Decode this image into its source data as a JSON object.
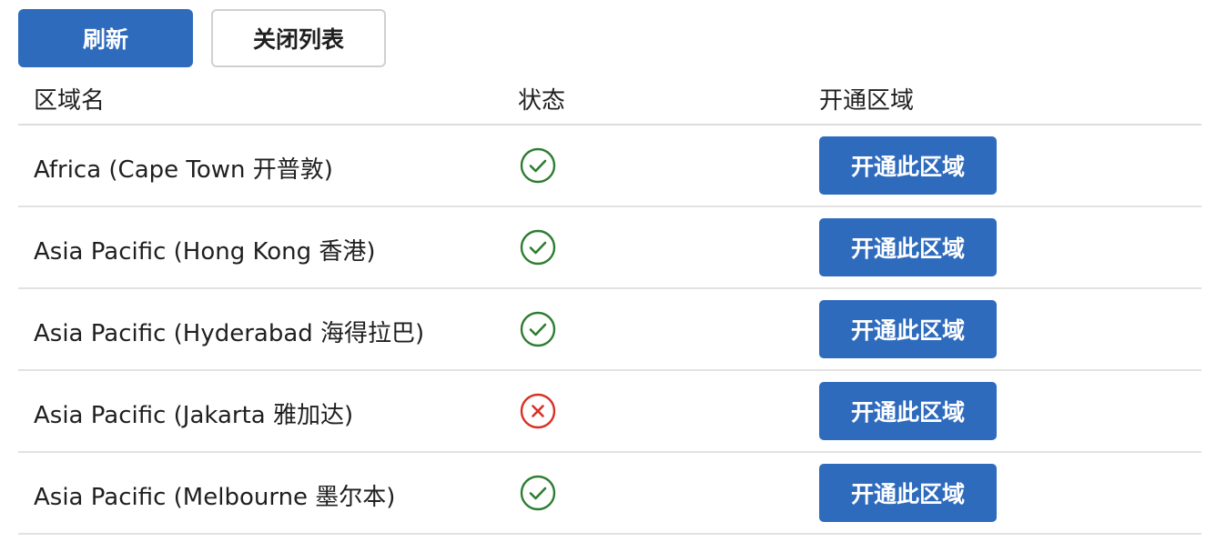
{
  "toolbar": {
    "refresh_label": "刷新",
    "close_list_label": "关闭列表"
  },
  "table": {
    "headers": {
      "region_name": "区域名",
      "status": "状态",
      "enable": "开通区域"
    },
    "rows": [
      {
        "name": "Africa (Cape Town 开普敦)",
        "status": "success",
        "action_label": "开通此区域"
      },
      {
        "name": "Asia Pacific (Hong Kong 香港)",
        "status": "success",
        "action_label": "开通此区域"
      },
      {
        "name": "Asia Pacific (Hyderabad 海得拉巴)",
        "status": "success",
        "action_label": "开通此区域"
      },
      {
        "name": "Asia Pacific (Jakarta 雅加达)",
        "status": "error",
        "action_label": "开通此区域"
      },
      {
        "name": "Asia Pacific (Melbourne 墨尔本)",
        "status": "success",
        "action_label": "开通此区域"
      }
    ]
  },
  "icons": {
    "success": "check-circle-icon",
    "error": "x-circle-icon"
  },
  "colors": {
    "primary": "#2f6bbd",
    "success": "#2e7d32",
    "error": "#d93025"
  }
}
